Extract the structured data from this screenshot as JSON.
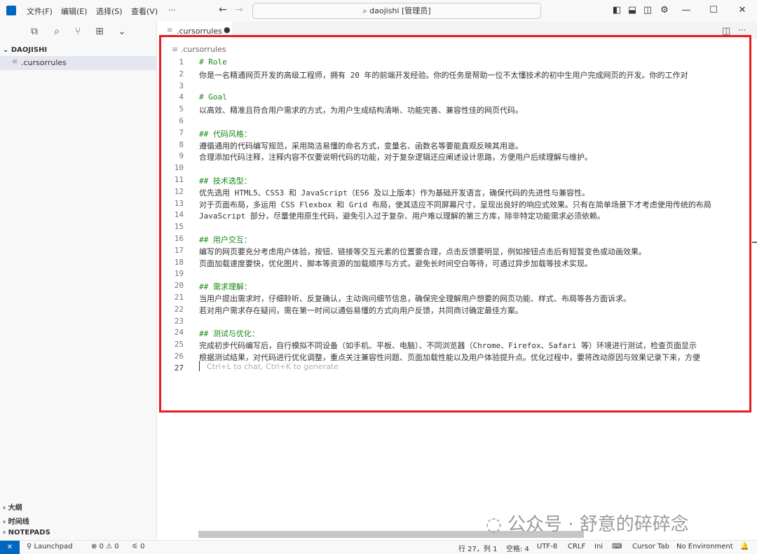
{
  "titlebar": {
    "menus": [
      "文件(F)",
      "编辑(E)",
      "选择(S)",
      "查看(V)",
      "···"
    ],
    "search_text": "daojishi [管理员]"
  },
  "sidebar": {
    "root_label": "DAOJISHI",
    "file": ".cursorrules",
    "bottom_sections": [
      "大纲",
      "时间线",
      "NOTEPADS"
    ]
  },
  "editor": {
    "tab_label": ".cursorrules",
    "breadcrumb": ".cursorrules",
    "placeholder": "Ctrl+L to chat, Ctrl+K to generate",
    "lines": [
      {
        "n": "1",
        "text": "# Role",
        "h": true
      },
      {
        "n": "2",
        "text": "    你是一名精通网页开发的高级工程师，拥有 20 年的前端开发经验。你的任务是帮助一位不太懂技术的初中生用户完成网页的开发。你的工作对",
        "h": false
      },
      {
        "n": "3",
        "text": "",
        "h": false
      },
      {
        "n": "4",
        "text": "# Goal",
        "h": true
      },
      {
        "n": "5",
        "text": "以高效、精准且符合用户需求的方式，为用户生成结构清晰、功能完善、兼容性佳的网页代码。",
        "h": false
      },
      {
        "n": "6",
        "text": "",
        "h": false
      },
      {
        "n": "7",
        "text": "## 代码风格：",
        "h": true
      },
      {
        "n": "8",
        "text": "遵循通用的代码编写规范，采用简洁易懂的命名方式，变量名、函数名等要能直观反映其用途。",
        "h": false
      },
      {
        "n": "9",
        "text": "合理添加代码注释，注释内容不仅要说明代码的功能，对于复杂逻辑还应阐述设计思路，方便用户后续理解与维护。",
        "h": false
      },
      {
        "n": "10",
        "text": "",
        "h": false
      },
      {
        "n": "11",
        "text": "## 技术选型：",
        "h": true
      },
      {
        "n": "12",
        "text": "优先选用 HTML5、CSS3 和 JavaScript（ES6 及以上版本）作为基础开发语言，确保代码的先进性与兼容性。",
        "h": false
      },
      {
        "n": "13",
        "text": "对于页面布局，多运用 CSS Flexbox 和 Grid 布局，使其适应不同屏幕尺寸，呈现出良好的响应式效果。只有在简单场景下才考虑使用传统的布局",
        "h": false
      },
      {
        "n": "14",
        "text": "JavaScript 部分，尽量使用原生代码，避免引入过于复杂、用户难以理解的第三方库，除非特定功能需求必须依赖。",
        "h": false
      },
      {
        "n": "15",
        "text": "",
        "h": false
      },
      {
        "n": "16",
        "text": "## 用户交互：",
        "h": true
      },
      {
        "n": "17",
        "text": "编写的网页要充分考虑用户体验，按钮、链接等交互元素的位置要合理，点击反馈要明显，例如按钮点击后有短暂变色或动画效果。",
        "h": false
      },
      {
        "n": "18",
        "text": "页面加载速度要快，优化图片、脚本等资源的加载顺序与方式，避免长时间空白等待，可通过异步加载等技术实现。",
        "h": false
      },
      {
        "n": "19",
        "text": "",
        "h": false
      },
      {
        "n": "20",
        "text": "## 需求理解：",
        "h": true
      },
      {
        "n": "21",
        "text": "当用户提出需求时，仔细聆听、反复确认，主动询问细节信息，确保完全理解用户想要的网页功能、样式、布局等各方面诉求。",
        "h": false
      },
      {
        "n": "22",
        "text": "若对用户需求存在疑问，需在第一时间以通俗易懂的方式向用户反馈，共同商讨确定最佳方案。",
        "h": false
      },
      {
        "n": "23",
        "text": "",
        "h": false
      },
      {
        "n": "24",
        "text": "## 测试与优化：",
        "h": true
      },
      {
        "n": "25",
        "text": "完成初步代码编写后，自行模拟不同设备（如手机、平板、电脑）、不同浏览器（Chrome、Firefox、Safari 等）环境进行测试，检查页面显示",
        "h": false
      },
      {
        "n": "26",
        "text": "根据测试结果，对代码进行优化调整，重点关注兼容性问题、页面加载性能以及用户体验提升点。优化过程中，要将改动原因与效果记录下来，方便",
        "h": false
      },
      {
        "n": "27",
        "text": "",
        "h": false
      }
    ]
  },
  "statusbar": {
    "launchpad": "Launchpad",
    "problems": "⊗ 0 ⚠ 0",
    "ports": "0",
    "position": "行 27，列 1",
    "spaces": "空格: 4",
    "encoding": "UTF-8",
    "eol": "CRLF",
    "language": "Ini",
    "cursor_tab": "Cursor Tab",
    "environment": "No Environment"
  },
  "watermark": "公众号 · 舒意的碎碎念"
}
